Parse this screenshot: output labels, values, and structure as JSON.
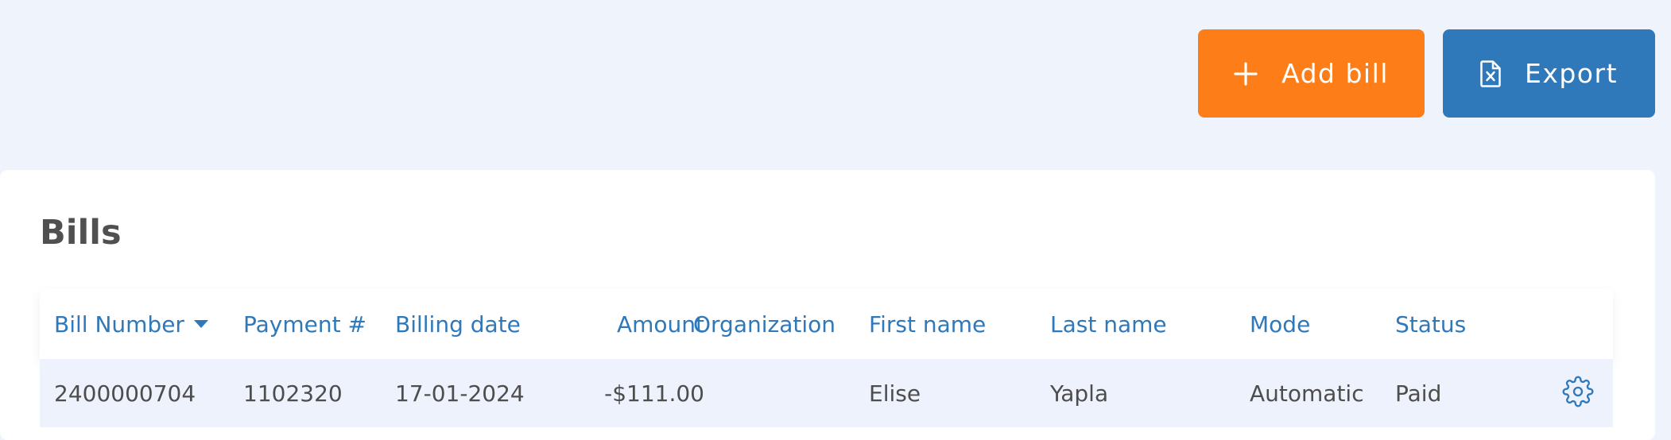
{
  "toolbar": {
    "add_label": "Add bill",
    "add_icon": "plus-icon",
    "export_label": "Export",
    "export_icon": "excel-file-icon"
  },
  "card": {
    "title": "Bills"
  },
  "table": {
    "columns": [
      "Bill Number",
      "Payment #",
      "Billing date",
      "Amount",
      "Organization",
      "First name",
      "Last name",
      "Mode",
      "Status"
    ],
    "sorted_column": "Bill Number",
    "sort_direction": "descending",
    "rows": [
      {
        "bill_number": "2400000704",
        "payment": "1102320",
        "billing_date": "17-01-2024",
        "amount": "-$111.00",
        "organization": "",
        "first_name": "Elise",
        "last_name": "Yapla",
        "mode": "Automatic",
        "status": "Paid",
        "action_icon": "gear-icon"
      }
    ]
  },
  "colors": {
    "background": "#eff3fc",
    "accent_orange": "#fd7e18",
    "accent_blue": "#2f78b9"
  }
}
